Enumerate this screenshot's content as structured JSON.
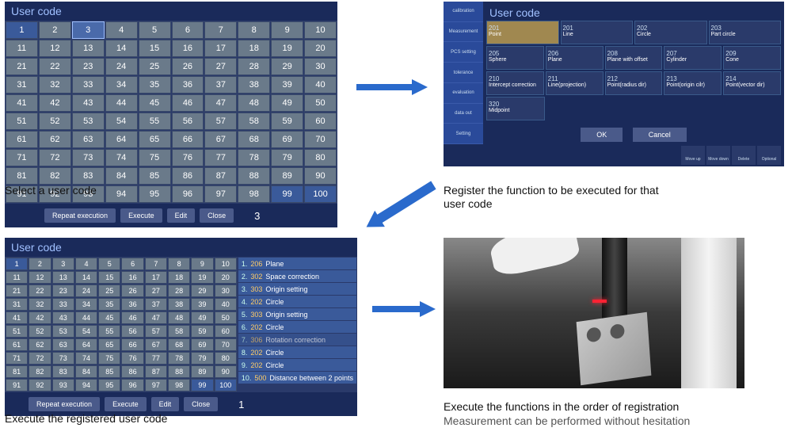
{
  "top_left": {
    "title": "User code",
    "selected_a": 1,
    "selected_b": 3,
    "buttons": [
      "Repeat execution",
      "Execute",
      "Edit",
      "Close"
    ],
    "footer_num": "3"
  },
  "top_right": {
    "title": "User code",
    "sidebar_items": [
      "calibration",
      "Measurement",
      "PCS setting",
      "tolerance",
      "evaluation",
      "data out",
      "Setting"
    ],
    "tiles_row1": [
      {
        "code": "201",
        "label": "Point",
        "hl": true
      },
      {
        "code": "201",
        "label": "Line"
      },
      {
        "code": "202",
        "label": "Circle"
      },
      {
        "code": "203",
        "label": "Part circle"
      }
    ],
    "tiles_row2": [
      {
        "code": "205",
        "label": "Sphere"
      },
      {
        "code": "206",
        "label": "Plane"
      },
      {
        "code": "208",
        "label": "Plane with offset"
      },
      {
        "code": "207",
        "label": "Cylinder"
      },
      {
        "code": "209",
        "label": "Cone"
      }
    ],
    "tiles_row3": [
      {
        "code": "210",
        "label": "Intercept correction"
      },
      {
        "code": "211",
        "label": "Line(projection)"
      },
      {
        "code": "212",
        "label": "Point(radius dir)"
      },
      {
        "code": "213",
        "label": "Point(origin cilr)"
      },
      {
        "code": "214",
        "label": "Point(vector dir)"
      }
    ],
    "tiles_row4": [
      {
        "code": "320",
        "label": "Midpoint"
      }
    ],
    "buttons": [
      "OK",
      "Cancel"
    ],
    "footer_icons": [
      "Move up",
      "Move down",
      "Delete",
      "Optional"
    ]
  },
  "bottom_left": {
    "title": "User code",
    "selected": 1,
    "buttons": [
      "Repeat execution",
      "Execute",
      "Edit",
      "Close"
    ],
    "footer_num": "1",
    "functions": [
      {
        "idx": "1.",
        "code": "206",
        "name": "Plane"
      },
      {
        "idx": "2.",
        "code": "302",
        "name": "Space correction"
      },
      {
        "idx": "3.",
        "code": "303",
        "name": "Origin setting"
      },
      {
        "idx": "4.",
        "code": "202",
        "name": "Circle"
      },
      {
        "idx": "5.",
        "code": "303",
        "name": "Origin setting"
      },
      {
        "idx": "6.",
        "code": "202",
        "name": "Circle"
      },
      {
        "idx": "7.",
        "code": "306",
        "name": "Rotation correction",
        "dim": true
      },
      {
        "idx": "8.",
        "code": "202",
        "name": "Circle"
      },
      {
        "idx": "9.",
        "code": "202",
        "name": "Circle"
      },
      {
        "idx": "10.",
        "code": "500",
        "name": "Distance between 2 points"
      }
    ]
  },
  "captions": {
    "tl": "Select a user code",
    "tr_l1": "Register the function to be executed for that",
    "tr_l2": "user code",
    "bl": "Execute the registered user code",
    "br_l1": "Execute the functions in the order of registration",
    "br_sub": "Measurement can be performed without hesitation"
  }
}
